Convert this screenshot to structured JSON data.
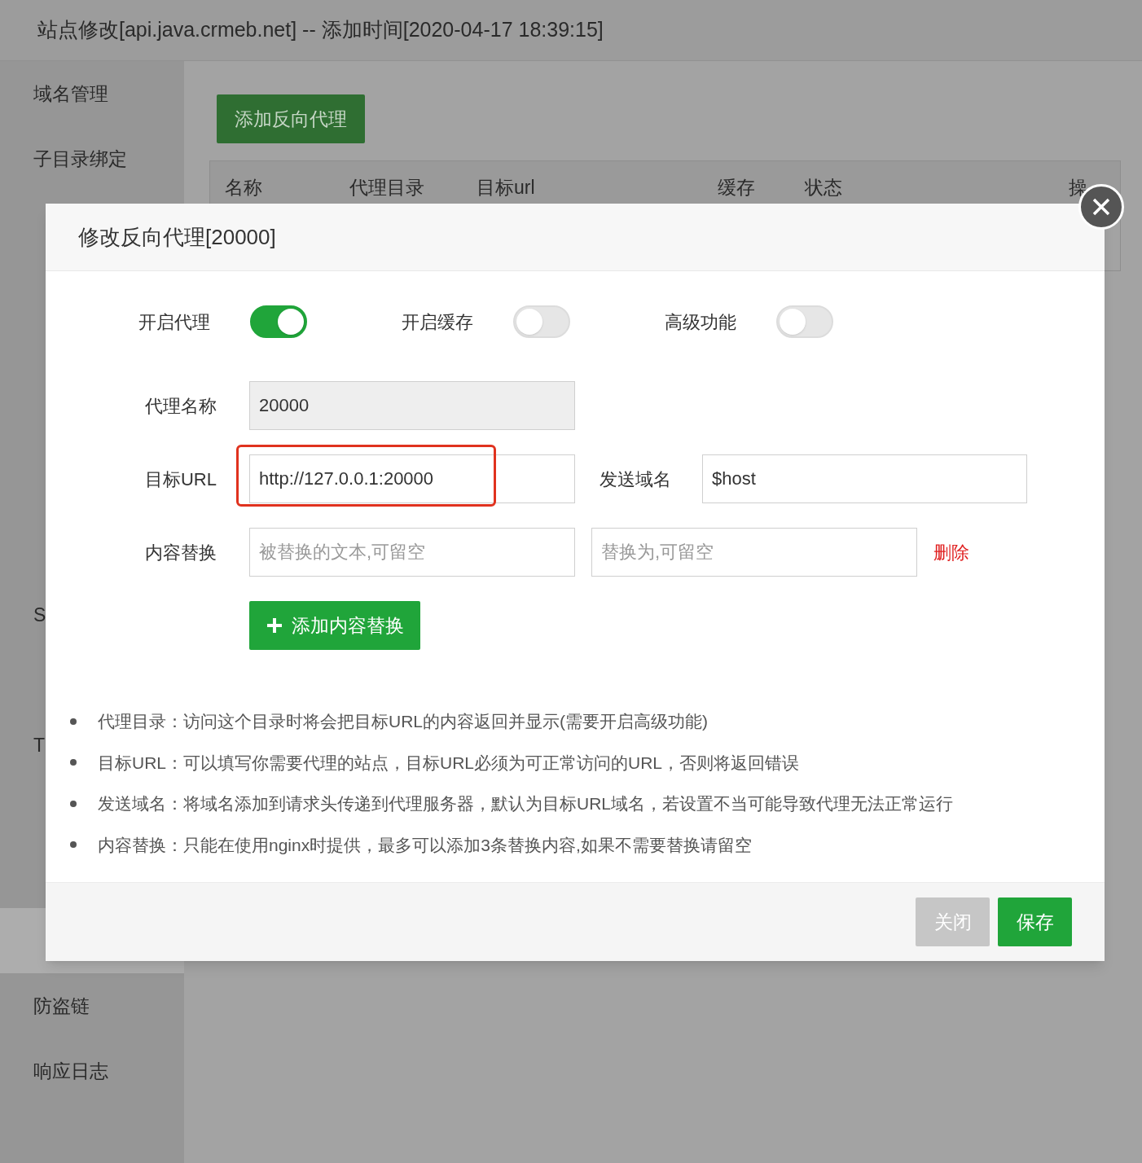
{
  "window": {
    "title": "站点修改[api.java.crmeb.net] -- 添加时间[2020-04-17 18:39:15]"
  },
  "sidebar": {
    "items": [
      {
        "label": "域名管理",
        "selected": false
      },
      {
        "label": "子目录绑定",
        "selected": false
      },
      {
        "selected": false
      },
      {
        "selected": false
      },
      {
        "selected": false
      },
      {
        "selected": false
      },
      {
        "selected": false
      },
      {
        "selected": false
      },
      {
        "label": "S",
        "selected": false
      },
      {
        "selected": false
      },
      {
        "label": "T",
        "selected": false
      },
      {
        "selected": false
      },
      {
        "selected": false
      },
      {
        "selected": true
      },
      {
        "label": "防盗链",
        "selected": false
      },
      {
        "label": "响应日志",
        "selected": false
      }
    ]
  },
  "content": {
    "add_button": "添加反向代理",
    "table": {
      "columns": [
        "名称",
        "代理目录",
        "目标url",
        "缓存",
        "状态",
        "操"
      ]
    }
  },
  "dialog": {
    "title": "修改反向代理[20000]",
    "toggles": [
      {
        "label": "开启代理",
        "on": true
      },
      {
        "label": "开启缓存",
        "on": false
      },
      {
        "label": "高级功能",
        "on": false
      }
    ],
    "name_field": {
      "label": "代理名称",
      "value": "20000",
      "disabled": true
    },
    "target_field": {
      "label": "目标URL",
      "value": "http://127.0.0.1:20000",
      "highlighted": true
    },
    "host_field": {
      "label": "发送域名",
      "value": "$host"
    },
    "replace": {
      "label": "内容替换",
      "from_placeholder": "被替换的文本,可留空",
      "to_placeholder": "替换为,可留空",
      "delete": "删除"
    },
    "add_replace_button": "添加内容替换",
    "notes": [
      "代理目录：访问这个目录时将会把目标URL的内容返回并显示(需要开启高级功能)",
      "目标URL：可以填写你需要代理的站点，目标URL必须为可正常访问的URL，否则将返回错误",
      "发送域名：将域名添加到请求头传递到代理服务器，默认为目标URL域名，若设置不当可能导致代理无法正常运行",
      "内容替换：只能在使用nginx时提供，最多可以添加3条替换内容,如果不需要替换请留空"
    ],
    "buttons": [
      {
        "label": "关闭",
        "kind": "secondary"
      },
      {
        "label": "保存",
        "kind": "primary"
      }
    ]
  }
}
